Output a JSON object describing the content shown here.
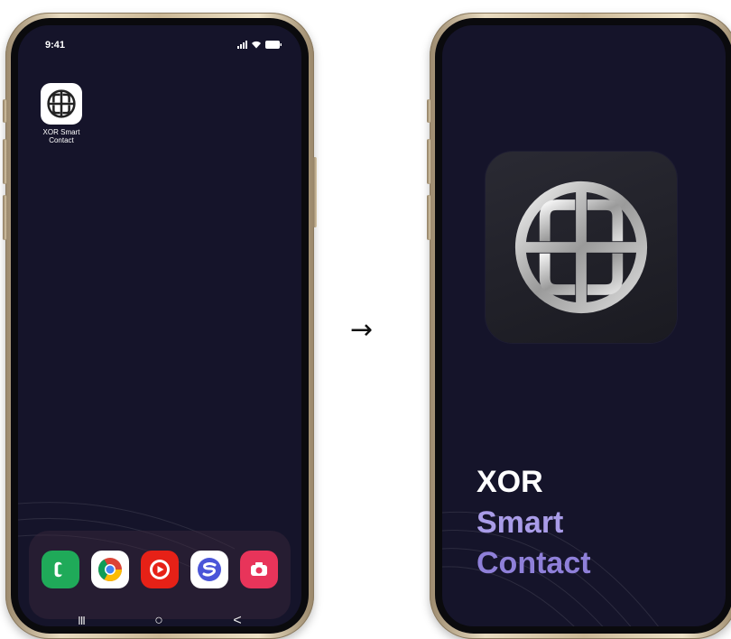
{
  "arrow": "→",
  "left_phone": {
    "status_bar": {
      "time": "9:41"
    },
    "home_app": {
      "label": "XOR Smart Contact",
      "icon": "xor-celtic-knot-icon"
    },
    "dock": {
      "apps": [
        {
          "name": "phone",
          "icon": "phone-icon",
          "color": "#1faa59"
        },
        {
          "name": "chrome",
          "icon": "chrome-icon",
          "color": "#ffffff"
        },
        {
          "name": "youtube",
          "icon": "youtube-icon",
          "color": "#e62117"
        },
        {
          "name": "samsung-internet",
          "icon": "browser-icon",
          "color": "#ffffff"
        },
        {
          "name": "camera",
          "icon": "camera-icon",
          "color": "#e8345a"
        }
      ]
    },
    "nav": {
      "recents": "III",
      "home": "○",
      "back": "<"
    }
  },
  "right_phone": {
    "splash": {
      "logo_icon": "xor-celtic-knot-icon",
      "line1": "XOR",
      "line2": "Smart",
      "line3": "Contact"
    }
  },
  "colors": {
    "screen_bg": "#15142a",
    "accent_light": "#a99ce8",
    "accent": "#8f80d9"
  }
}
